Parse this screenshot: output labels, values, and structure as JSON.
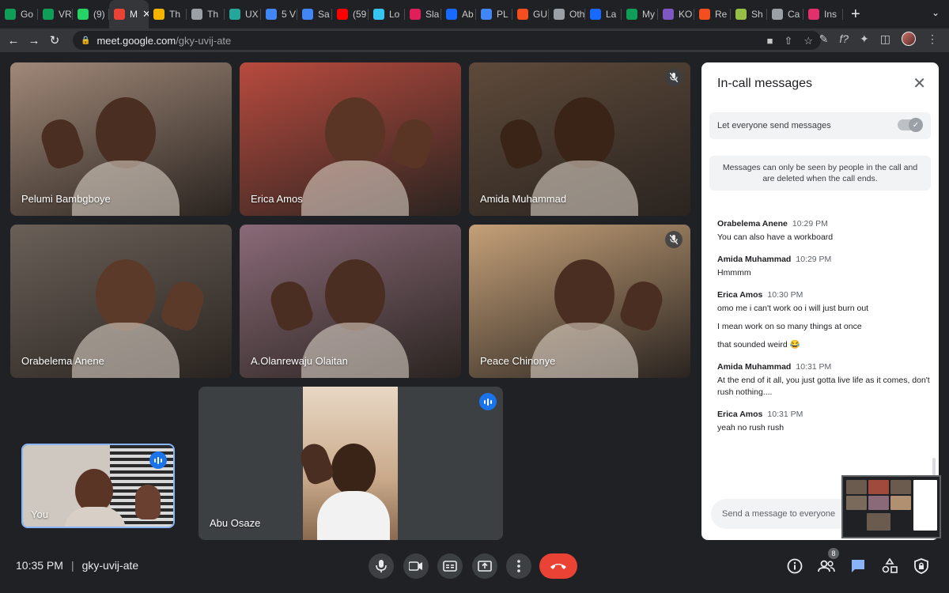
{
  "browser": {
    "tabs": [
      {
        "label": "Go",
        "color": "#0f9d58"
      },
      {
        "label": "VR",
        "color": "#0f9d58"
      },
      {
        "label": "(9)",
        "color": "#25d366"
      },
      {
        "label": "M",
        "color": "#ea4335",
        "active": true
      },
      {
        "label": "Th",
        "color": "#f4b400"
      },
      {
        "label": "Th",
        "color": "#9aa0a6"
      },
      {
        "label": "UX",
        "color": "#26a69a"
      },
      {
        "label": "5 V",
        "color": "#4285f4"
      },
      {
        "label": "Sa",
        "color": "#4285f4"
      },
      {
        "label": "(59",
        "color": "#ff0000"
      },
      {
        "label": "Lo",
        "color": "#36c5f0"
      },
      {
        "label": "Sla",
        "color": "#e01e5a"
      },
      {
        "label": "Ab",
        "color": "#1769ff"
      },
      {
        "label": "PL",
        "color": "#4285f4"
      },
      {
        "label": "GU",
        "color": "#f24e1e"
      },
      {
        "label": "Oth",
        "color": "#9aa0a6"
      },
      {
        "label": "La",
        "color": "#1769ff"
      },
      {
        "label": "My",
        "color": "#0f9d58"
      },
      {
        "label": "KO",
        "color": "#7e57c2"
      },
      {
        "label": "Re",
        "color": "#f24e1e"
      },
      {
        "label": "Sh",
        "color": "#95bf47"
      },
      {
        "label": "Ca",
        "color": "#9aa0a6"
      },
      {
        "label": "Ins",
        "color": "#e1306c"
      }
    ],
    "new_tab_label": "+",
    "url_host": "meet.google.com",
    "url_path": "/gky-uvij-ate"
  },
  "participants": [
    {
      "name": "Pelumi Bambgboye",
      "muted": false,
      "bg": "#a08878",
      "skin": "#4a2e22"
    },
    {
      "name": "Erica Amos",
      "muted": false,
      "bg": "#b84a3e",
      "skin": "#5a3526"
    },
    {
      "name": "Amida Muhammad",
      "muted": true,
      "bg": "#5e4a3a",
      "skin": "#3a2418"
    },
    {
      "name": "Orabelema Anene",
      "muted": false,
      "bg": "#6a6058",
      "skin": "#5c3a2a"
    },
    {
      "name": "A.Olanrewaju Olaitan",
      "muted": false,
      "bg": "#8a6a78",
      "skin": "#4a2e22"
    },
    {
      "name": "Peace Chinonye",
      "muted": true,
      "bg": "#c4a078",
      "skin": "#4a2e22"
    }
  ],
  "spotlight": {
    "name": "Abu Osaze",
    "speaking": true
  },
  "self_tile": {
    "name": "You",
    "speaking": true
  },
  "chat": {
    "title": "In-call messages",
    "toggle_label": "Let everyone send messages",
    "toggle_on": true,
    "notice": "Messages can only be seen by people in the call and are deleted when the call ends.",
    "messages": [
      {
        "sender": "Orabelema Anene",
        "time": "10:29 PM",
        "lines": [
          "You can also have a workboard"
        ]
      },
      {
        "sender": "Amida Muhammad",
        "time": "10:29 PM",
        "lines": [
          "Hmmmm"
        ]
      },
      {
        "sender": "Erica Amos",
        "time": "10:30 PM",
        "lines": [
          "omo me i can't work oo i will just burn out",
          "I mean work on so many things at once",
          "that sounded weird 😂"
        ]
      },
      {
        "sender": "Amida Muhammad",
        "time": "10:31 PM",
        "lines": [
          "At the end of it all, you just gotta live life as it comes, don't rush nothing...."
        ]
      },
      {
        "sender": "Erica Amos",
        "time": "10:31 PM",
        "lines": [
          "yeah no rush rush"
        ]
      }
    ],
    "input_placeholder": "Send a message to everyone"
  },
  "bottom_bar": {
    "time": "10:35 PM",
    "meeting_code": "gky-uvij-ate",
    "participant_count": "8"
  },
  "colors": {
    "background": "#202124",
    "tile": "#3c4043",
    "end_call": "#ea4335",
    "chat_active": "#8ab4f8",
    "speaking": "#1a73e8"
  },
  "icons": {
    "mic": "mic-icon",
    "camera": "camera-icon",
    "captions": "captions-icon",
    "present": "present-icon",
    "more": "more-vert-icon",
    "end_call": "end-call-icon",
    "info": "info-icon",
    "people": "people-icon",
    "chat": "chat-icon",
    "activities": "activities-icon",
    "host_controls": "shield-icon"
  }
}
